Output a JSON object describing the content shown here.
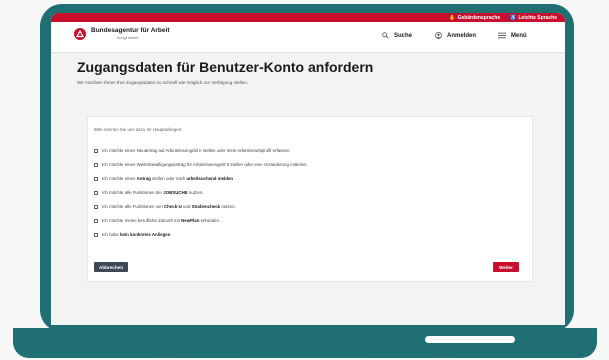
{
  "top_bar": {
    "sign_language": "Gebärdensprache",
    "easy_language": "Leichte Sprache"
  },
  "header": {
    "logo_title": "Bundesagentur für Arbeit",
    "logo_subtitle": "bringt weiter",
    "search_label": "Suche",
    "login_label": "Anmelden",
    "menu_label": "Menü"
  },
  "main": {
    "title": "Zugangsdaten für Benutzer-Konto anfordern",
    "subtitle": "Wir möchten Ihnen Ihre Zugangsdaten so schnell wie möglich zur Verfügung stellen.",
    "prompt": "Bitte nennen Sie uns dazu Ihr Hauptanliegen:",
    "options": [
      {
        "pre": "Ich möchte einen Neuantrag auf Arbeitslosengeld II stellen oder mein Arbeitsmarktprofil erfassen.",
        "bold": "",
        "post": ""
      },
      {
        "pre": "Ich möchte einen Weiterbewilligungsantrag für Arbeitslosengeld II stellen oder eine Veränderung mitteilen.",
        "bold": "",
        "post": ""
      },
      {
        "pre": "Ich möchte einen ",
        "bold": "Antrag",
        "post": " stellen oder mich ",
        "bold2": "arbeitsuchend melden"
      },
      {
        "pre": "Ich möchte alle Funktionen der ",
        "bold": "JOBSUCHE",
        "post": " nutzen."
      },
      {
        "pre": "Ich möchte alle Funktionen von ",
        "bold": "Check-U",
        "post": " und ",
        "bold2": "Studiencheck",
        "post2": " nutzen."
      },
      {
        "pre": "Ich möchte meine berufliche Zukunft mit ",
        "bold": "NewPlan",
        "post": " erkunden."
      },
      {
        "pre": "Ich habe ",
        "bold": "kein konkretes Anliegen",
        "post": ""
      }
    ],
    "cancel_label": "Abbrechen",
    "next_label": "Weiter"
  },
  "colors": {
    "brand_red": "#c8102e",
    "laptop_teal": "#1f6f73",
    "button_dark": "#3d4a55"
  }
}
